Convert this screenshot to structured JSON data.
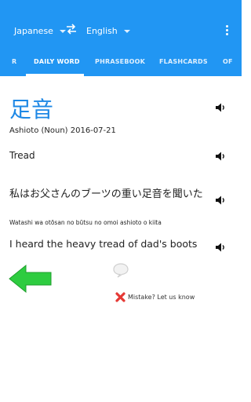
{
  "header": {
    "source_lang": "Japanese",
    "target_lang": "English",
    "tabs": [
      {
        "label": "R"
      },
      {
        "label": "DAILY WORD"
      },
      {
        "label": "PHRASEBOOK"
      },
      {
        "label": "FLASHCARDS"
      },
      {
        "label": "OF"
      }
    ],
    "active_tab": "DAILY WORD",
    "accent_color": "#2196f3"
  },
  "daily_word": {
    "word": "足音",
    "info": "Ashioto (Noun) 2016-07-21",
    "meaning": "Tread",
    "example_japanese": "私はお父さんのブーツの重い足音を聞いた",
    "example_romaji": "Watashi wa otōsan no būtsu no omoi ashioto o kiita",
    "example_english": "I heard the heavy tread of dad's boots",
    "word_color": "#1e88e5"
  },
  "actions": {
    "report_label": "Mistake? Let us know",
    "back_arrow_color": "#2ecc40"
  }
}
